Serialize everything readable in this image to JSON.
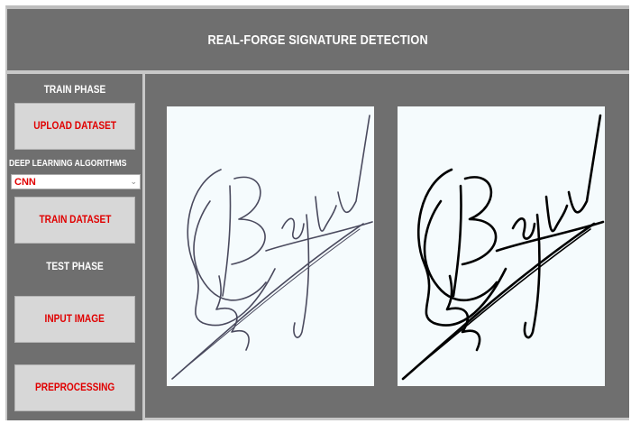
{
  "window": {
    "title": "REAL-FORGE SIGNATURE DETECTION"
  },
  "sidebar": {
    "train_phase_label": "TRAIN PHASE",
    "upload_button": "UPLOAD DATASET",
    "algorithms_label": "DEEP LEARNING ALGORITHMS",
    "algorithm_selected": "CNN",
    "train_button": "TRAIN DATASET",
    "test_phase_label": "TEST PHASE",
    "input_button": "INPUT IMAGE",
    "preprocess_button": "PREPROCESSING"
  },
  "images": [
    {
      "name": "original-signature",
      "ink": "#4a4a5e"
    },
    {
      "name": "processed-signature",
      "ink": "#000000"
    }
  ],
  "colors": {
    "background": "#6f6f6f",
    "button_face": "#d7d7d7",
    "button_text": "#e00000",
    "label_text": "#ffffff"
  }
}
